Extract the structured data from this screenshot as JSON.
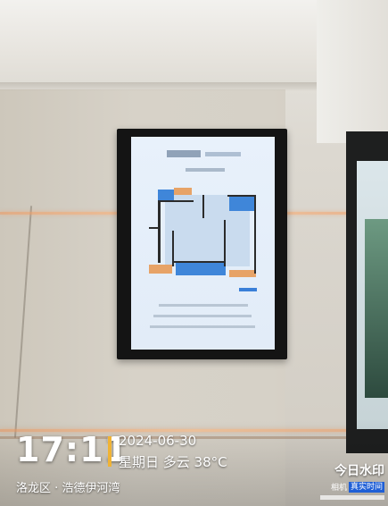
{
  "watermark": {
    "time": "17:11",
    "date": "2024-06-30",
    "weather": "星期日 多云 38°C",
    "location": "洛龙区 · 浩德伊河湾",
    "brand_name": "今日水印",
    "brand_badge_left": "相机",
    "brand_badge_right": "真实时间",
    "divider_color": "#f0b335"
  },
  "scene": {
    "screen_content": "floor-plan-advertisement",
    "plan_colors": {
      "blue": "#3f86d9",
      "orange": "#e7a367"
    }
  }
}
